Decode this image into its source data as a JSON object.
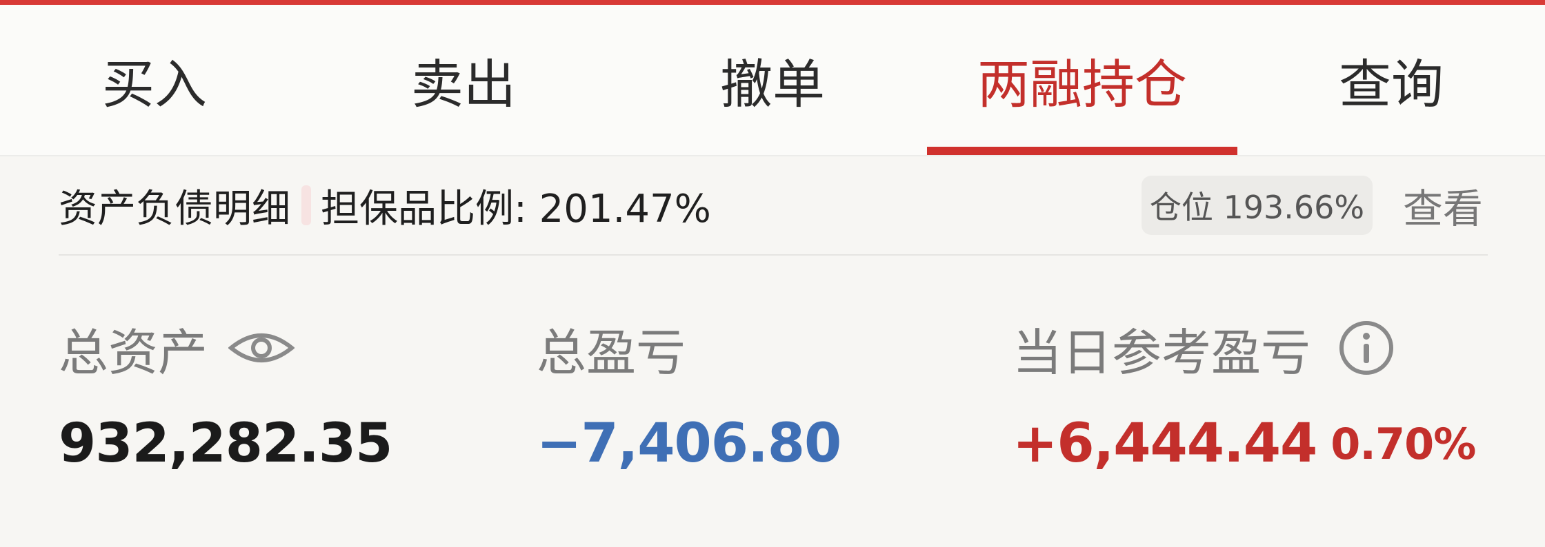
{
  "tabs": [
    {
      "label": "买入"
    },
    {
      "label": "卖出"
    },
    {
      "label": "撤单"
    },
    {
      "label": "两融持仓"
    },
    {
      "label": "查询"
    }
  ],
  "active_tab": "两融持仓",
  "summary": {
    "detail_label": "资产负债明细",
    "collateral_ratio_label": "担保品比例: 201.47%",
    "position_label": "仓位 193.66%",
    "view_label": "查看"
  },
  "metrics": {
    "total_assets": {
      "label": "总资产",
      "value": "932,282.35",
      "icon": "eye-icon"
    },
    "total_pnl": {
      "label": "总盈亏",
      "value": "−7,406.80",
      "color": "#3f6fb5"
    },
    "daily_pnl": {
      "label": "当日参考盈亏",
      "value": "+6,444.44",
      "percent": "0.70%",
      "color": "#c32f2b",
      "icon": "info-icon"
    }
  },
  "colors": {
    "accent": "#d0312d",
    "positive": "#c32f2b",
    "negative": "#3f6fb5"
  }
}
